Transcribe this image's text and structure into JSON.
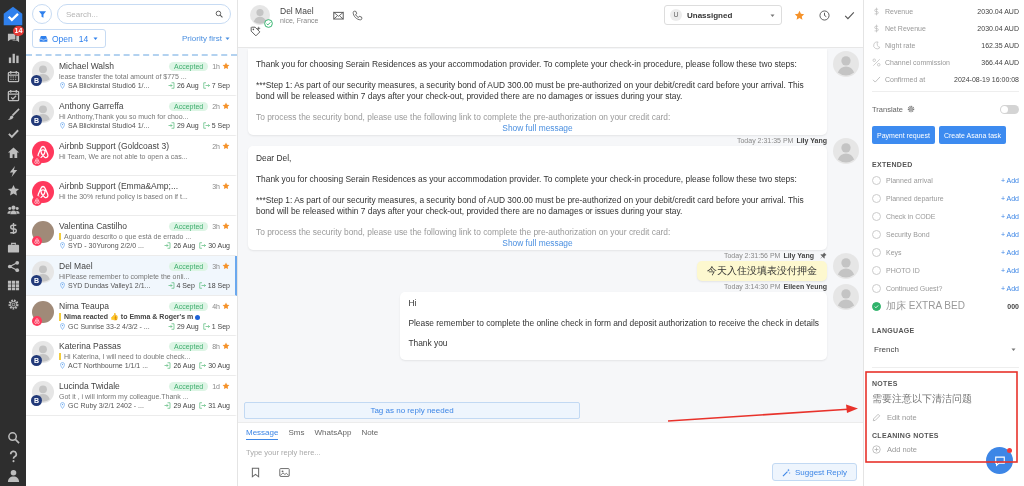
{
  "nav": {
    "badge": "14"
  },
  "inbox": {
    "search_placeholder": "Search...",
    "filter": "Open",
    "count": "14",
    "sort": "Priority first"
  },
  "conversations": [
    {
      "name": "Michael Walsh",
      "status": "Accepted",
      "time": "1h",
      "starred": true,
      "preview": "lease transfer the total amount of $775 ...",
      "avatar": {
        "kind": "default"
      },
      "channel": {
        "kind": "booking",
        "badge": "B"
      },
      "flagged": false,
      "unread": false,
      "location": "SA Blickinstal Studio6 1/...",
      "check_in": "26 Aug",
      "check_out": "7 Sep",
      "selected": false
    },
    {
      "name": "Anthony Garreffa",
      "status": "Accepted",
      "time": "2h",
      "starred": true,
      "preview": "Hi Anthony,Thank you so much for choo...",
      "avatar": {
        "kind": "default"
      },
      "channel": {
        "kind": "booking",
        "badge": "B"
      },
      "flagged": false,
      "unread": false,
      "location": "SA Blickinstal Studio4 1/...",
      "check_in": "29 Aug",
      "check_out": "5 Sep",
      "selected": false
    },
    {
      "name": "Airbnb Support (Goldcoast 3)",
      "time": "2h",
      "starred": true,
      "preview": "Hi Team,  We are not able to open a cas...",
      "avatar": {
        "kind": "airbnb"
      },
      "channel": {
        "kind": "airbnb"
      },
      "flagged": false,
      "unread": false,
      "selected": false
    },
    {
      "name": "Airbnb Support (Emma&Amp;...",
      "time": "3h",
      "starred": true,
      "preview": "Hi the 30% refund policy is based on if t...",
      "avatar": {
        "kind": "airbnb"
      },
      "channel": {
        "kind": "airbnb"
      },
      "flagged": false,
      "unread": false,
      "selected": false
    },
    {
      "name": "Valentina Castilho",
      "status": "Accepted",
      "time": "3h",
      "starred": true,
      "preview": "Aguardo descrito o que está de errado ...",
      "avatar": {
        "kind": "photo"
      },
      "channel": {
        "kind": "airbnb"
      },
      "flagged": true,
      "unread": false,
      "location": "SYD - 30Yurong 2/2/0 ...",
      "check_in": "26 Aug",
      "check_out": "30 Aug",
      "selected": false
    },
    {
      "name": "Del Mael",
      "status": "Accepted",
      "time": "3h",
      "starred": true,
      "preview": "HiPlease remember to complete the onli...",
      "avatar": {
        "kind": "default"
      },
      "channel": {
        "kind": "booking",
        "badge": "B"
      },
      "flagged": false,
      "unread": false,
      "location": "SYD Dundas Valley1 2/1...",
      "check_in": "4 Sep",
      "check_out": "18 Sep",
      "selected": true
    },
    {
      "name": "Nima Teaupa",
      "status": "Accepted",
      "time": "4h",
      "starred": true,
      "preview": "Nima reacted 👍 to Emma & Roger's m",
      "avatar": {
        "kind": "photo"
      },
      "channel": {
        "kind": "airbnb"
      },
      "flagged": true,
      "unread": true,
      "location": "GC Sunrise 33-2 4/3/2 - ...",
      "check_in": "29 Aug",
      "check_out": "1 Sep",
      "selected": false
    },
    {
      "name": "Katerina Passas",
      "status": "Accepted",
      "time": "8h",
      "starred": true,
      "preview": "Hi Katerina, I will need to double check...",
      "avatar": {
        "kind": "default"
      },
      "channel": {
        "kind": "booking",
        "badge": "B"
      },
      "flagged": true,
      "unread": false,
      "location": "ACT Northbourne 1/1/1 ...",
      "check_in": "26 Aug",
      "check_out": "30 Aug",
      "selected": false
    },
    {
      "name": "Lucinda Twidale",
      "status": "Accepted",
      "time": "1d",
      "starred": true,
      "preview": "Got it , i will inform my colleague.Thank ...",
      "avatar": {
        "kind": "default"
      },
      "channel": {
        "kind": "booking",
        "badge": "B"
      },
      "flagged": false,
      "unread": false,
      "location": "GC Ruby 3/2/1 2402 - ...",
      "check_in": "29 Aug",
      "check_out": "31 Aug",
      "selected": false
    }
  ],
  "chat": {
    "contact": {
      "name": "Del Mael",
      "location": "nice, France",
      "verified": true
    },
    "assignee": {
      "initial": "U",
      "name": "Unassigned"
    },
    "starred": true,
    "messages": [
      {
        "kind": "email",
        "paragraphs": [
          "Thank you for choosing Serain Residences as your accommodation provider. To complete your check-in procedure, please follow these two steps:",
          "***Step 1: As part of our security measures, a security bond of AUD 300.00 must be pre-authorized on your debit/credit card before your arrival. This bond will be released within 7 days after your check-out, provided there are no damages or issues during your stay.",
          "To process the security bond, please use the following link to complete the pre-authorization on your credit card:"
        ],
        "more": "Show full message"
      },
      {
        "kind": "email",
        "time": "Today 2:31:35 PM",
        "author": "Lily Yang",
        "paragraphs": [
          "Dear Del,",
          "Thank you for choosing Serain Residences as your accommodation provider. To complete your check-in procedure, please follow these two steps:",
          "***Step 1: As part of our security measures, a security bond of AUD 300.00 must be pre-authorized on your debit/credit card before your arrival. This bond will be released within 7 days after your check-out, provided there are no damages or issues during your stay.",
          "To process the security bond, please use the following link to complete the pre-authorization on your credit card:"
        ],
        "more": "Show full message"
      },
      {
        "kind": "note",
        "time": "Today 2:31:56 PM",
        "author": "Lily Yang",
        "pinned": true,
        "paragraphs": [
          "今天入住没填表没付押金"
        ]
      },
      {
        "kind": "text",
        "time": "Today 3:14:30 PM",
        "author": "Eileen Yeung",
        "paragraphs": [
          "Hi",
          "Please remember to complete the online check in form and deposit authorization to receive the check in details",
          "Thank you"
        ]
      }
    ],
    "tag_button": "Tag as no reply needed",
    "reply_tabs": [
      {
        "label": "Message",
        "selected": true
      },
      {
        "label": "Sms",
        "selected": false
      },
      {
        "label": "WhatsApp",
        "selected": false
      },
      {
        "label": "Note",
        "selected": false
      }
    ],
    "reply_placeholder": "Type your reply here...",
    "suggest_button": "Suggest Reply"
  },
  "details": {
    "stats": [
      {
        "label": "Revenue",
        "value": "2030.04 AUD"
      },
      {
        "label": "Net Revenue",
        "value": "2030.04 AUD"
      },
      {
        "label": "Night rate",
        "value": "162.35 AUD"
      },
      {
        "label": "Channel commission",
        "value": "366.44 AUD"
      },
      {
        "label": "Confirmed at",
        "value": "2024-08-19 16:00:08"
      }
    ],
    "translate": {
      "label": "Translate",
      "on": false
    },
    "buttons": [
      "Payment request",
      "Create Asana task"
    ],
    "extended": {
      "title": "EXTENDED",
      "items": [
        {
          "label": "Planned arrival",
          "done": false,
          "action": "+ Add"
        },
        {
          "label": "Planned departure",
          "done": false,
          "action": "+ Add"
        },
        {
          "label": "Check in CODE",
          "done": false,
          "action": "+ Add"
        },
        {
          "label": "Security Bond",
          "done": false,
          "action": "+ Add"
        },
        {
          "label": "Keys",
          "done": false,
          "action": "+ Add"
        },
        {
          "label": "PHOTO ID",
          "done": false,
          "action": "+ Add"
        },
        {
          "label": "Continued Guest?",
          "done": false,
          "action": "+ Add"
        },
        {
          "label": "加床 EXTRA BED",
          "done": true,
          "value": "000"
        }
      ]
    },
    "language": {
      "title": "LANGUAGE",
      "value": "French"
    },
    "notes": {
      "title": "NOTES",
      "text": "需要注意以下清洁问题",
      "edit": "Edit note"
    },
    "cleaning_notes": {
      "title": "CLEANING NOTES",
      "add": "Add note"
    }
  },
  "chat_launcher": {
    "unread": true
  },
  "highlight": {
    "frame": true,
    "arrow": true
  }
}
